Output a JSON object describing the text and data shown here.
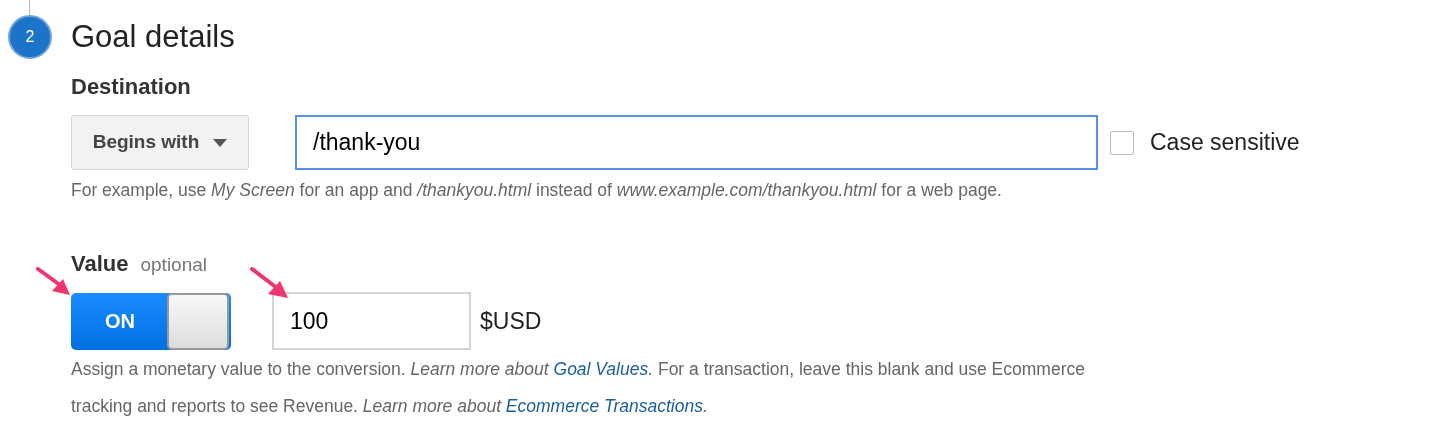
{
  "step": {
    "number": "2",
    "title": "Goal details"
  },
  "destination": {
    "label": "Destination",
    "match_type": "Begins with",
    "value": "/thank-you",
    "focused": true,
    "case_sensitive": {
      "label": "Case sensitive",
      "checked": false
    },
    "help": "For example, use *My Screen* for an app and */thankyou.html* instead of *www.example.com/thankyou.html* for a web page."
  },
  "value": {
    "label": "Value",
    "hint": "optional",
    "toggle": {
      "on": true,
      "label": "ON"
    },
    "amount": "100",
    "currency": "$USD",
    "help": [
      {
        "kind": "text",
        "text": "Assign a monetary value to the conversion. "
      },
      {
        "kind": "italic",
        "text": "Learn more about "
      },
      {
        "kind": "link",
        "text": "Goal Values"
      },
      {
        "kind": "italic",
        "text": "."
      },
      {
        "kind": "text",
        "text": " For a transaction, leave this blank and use Ecommerce tracking and reports to see Revenue. "
      },
      {
        "kind": "italic",
        "text": "Learn more about "
      },
      {
        "kind": "link",
        "text": "Ecommerce Transactions"
      },
      {
        "kind": "italic",
        "text": "."
      }
    ]
  }
}
